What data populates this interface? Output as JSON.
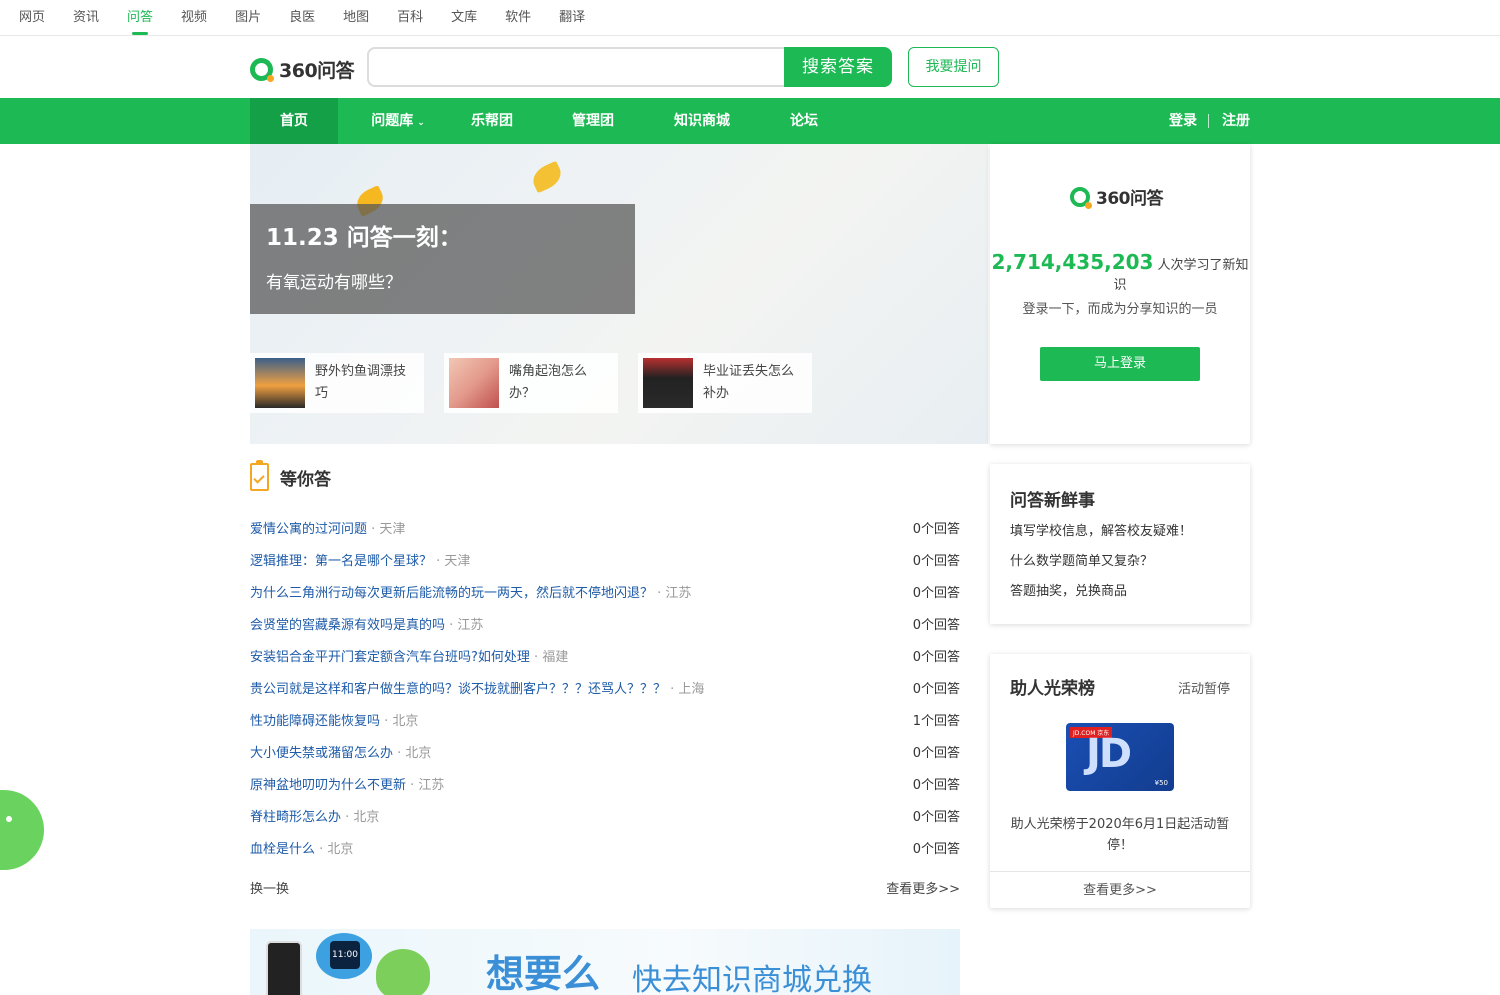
{
  "channels": [
    "网页",
    "资讯",
    "问答",
    "视频",
    "图片",
    "良医",
    "地图",
    "百科",
    "文库",
    "软件",
    "翻译"
  ],
  "active_channel": "问答",
  "header": {
    "logo_text": "360问答",
    "search_placeholder": "",
    "search_button": "搜索答案",
    "ask_button": "我要提问"
  },
  "menu": {
    "items": [
      "首页",
      "问题库",
      "乐帮团",
      "管理团",
      "知识商城",
      "论坛"
    ],
    "login": "登录",
    "register": "注册"
  },
  "banner": {
    "title": "11.23 问答一刻：",
    "subtitle": "有氧运动有哪些？",
    "cards": [
      {
        "text": "野外钓鱼调漂技巧",
        "image": "fishing-sunset"
      },
      {
        "text": "嘴角起泡怎么办？",
        "image": "lips-closeup"
      },
      {
        "text": "毕业证丢失怎么补办",
        "image": "graduate-photo"
      }
    ]
  },
  "login_panel": {
    "logo_text": "360问答",
    "count": "2,714,435,203",
    "count_suffix": "人次学习了新知识",
    "tip": "登录一下，而成为分享知识的一员",
    "button": "马上登录"
  },
  "news_panel": {
    "title": "问答新鲜事",
    "items": [
      "填写学校信息，解答校友疑难！",
      "什么数学题简单又复杂？",
      "答题抽奖，兑换商品"
    ]
  },
  "rank_panel": {
    "title": "助人光荣榜",
    "status": "活动暂停",
    "card_tag": "JD.COM 京东",
    "card_letters": "JD",
    "card_value": "¥50",
    "note": "助人光荣榜于2020年6月1日起活动暂停！",
    "more": "查看更多>>"
  },
  "wait": {
    "title": "等你答",
    "questions": [
      {
        "q": "爱情公寓的过河问题",
        "loc": "天津",
        "count": "0个回答"
      },
      {
        "q": "逻辑推理：第一名是哪个星球？",
        "loc": "天津",
        "count": "0个回答"
      },
      {
        "q": "为什么三角洲行动每次更新后能流畅的玩一两天，然后就不停地闪退？",
        "loc": "江苏",
        "count": "0个回答"
      },
      {
        "q": "会贤堂的窖藏桑源有效吗是真的吗",
        "loc": "江苏",
        "count": "0个回答"
      },
      {
        "q": "安装铝合金平开门套定额含汽车台班吗?如何处理",
        "loc": "福建",
        "count": "0个回答"
      },
      {
        "q": "贵公司就是这样和客户做生意的吗？谈不拢就删客户？？？还骂人？？？",
        "loc": "上海",
        "count": "0个回答"
      },
      {
        "q": "性功能障碍还能恢复吗",
        "loc": "北京",
        "count": "1个回答"
      },
      {
        "q": "大小便失禁或潴留怎么办",
        "loc": "北京",
        "count": "0个回答"
      },
      {
        "q": "原神盆地叨叨为什么不更新",
        "loc": "江苏",
        "count": "0个回答"
      },
      {
        "q": "脊柱畸形怎么办",
        "loc": "北京",
        "count": "0个回答"
      },
      {
        "q": "血栓是什么",
        "loc": "北京",
        "count": "0个回答"
      }
    ],
    "refresh": "换一换",
    "more": "查看更多>>"
  },
  "promo": {
    "big": "想要么",
    "small": "快去知识商城兑换",
    "watch_time": "11:00"
  },
  "colors": {
    "brand_green": "#1db954",
    "link_blue": "#1e5ba8",
    "accent_orange": "#f5a623"
  }
}
